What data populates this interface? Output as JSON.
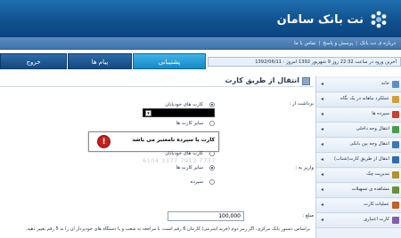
{
  "header": {
    "logo_text": "نت بانک سامان"
  },
  "navbar": {
    "links": [
      "درباره ی نت بانک",
      "پرسش و پاسخ",
      "تماس با ما"
    ]
  },
  "tabs": {
    "tab1": "پشتیبانی",
    "tab2": "پیام ها",
    "tab3": "خروج"
  },
  "statusbar": {
    "text": "آخرین ورود در ساعت 22:32 روز 9 شهریور 1392  امروز :  1392/06/11"
  },
  "main": {
    "title": "انتقال از طریق کارت"
  },
  "form": {
    "from_label": "برداشت از :",
    "from_options": [
      "کارت های خودبانان",
      "سایر کارت ها"
    ],
    "to_label": "واریز به :",
    "to_options": [
      "کارت های خودبانان",
      "سایر کارت ها",
      "سپرده"
    ],
    "amount_label": "مبلغ :",
    "amount_value": "100,000",
    "ghost_card": "6104 3377 7913 7737"
  },
  "alert": {
    "message": "کارت یا سپرده نامعتبر می باشد"
  },
  "note": "براساس دستور بانک مرکزی، اگر رمز دوم (خرید اینترنتی) کارتتان 6 رقم است، با مراجعه به شعب و یا دستگاه های خودپرداز آن را به 5 رقم تغییر دهید.",
  "sidebar": {
    "items": [
      {
        "label": "خانه",
        "icon": "home-icon",
        "color": "#5b8fc9"
      },
      {
        "label": "عملکرد ماهانه در یک نگاه",
        "icon": "chart-icon",
        "color": "#d3a13a"
      },
      {
        "label": "سپرده ها",
        "icon": "deposit-icon",
        "color": "#c8412f"
      },
      {
        "label": "انتقال وجه داخلی",
        "icon": "transfer-icon",
        "color": "#4a9a4a"
      },
      {
        "label": "انتقال وجه بین بانکی",
        "icon": "bank-icon",
        "color": "#3977b8"
      },
      {
        "label": "انتقال از طریق کارت(شتاب)",
        "icon": "card-icon",
        "color": "#2f6db3"
      },
      {
        "label": "مدیریت چک",
        "icon": "cheque-icon",
        "color": "#b0902f"
      },
      {
        "label": "مشاهده ی تسهیلات",
        "icon": "loan-icon",
        "color": "#6a8e3a"
      },
      {
        "label": "عملیات کارت",
        "icon": "card-ops-icon",
        "color": "#c55c2a"
      },
      {
        "label": "کارت اعتباری",
        "icon": "credit-card-icon",
        "color": "#7f5fb0"
      }
    ]
  }
}
